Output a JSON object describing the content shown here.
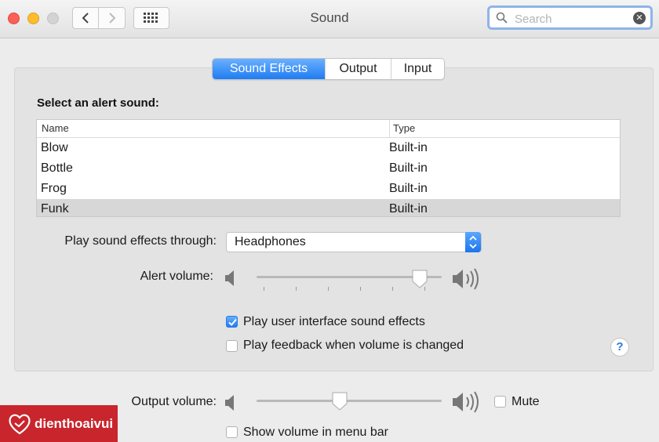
{
  "window": {
    "title": "Sound"
  },
  "search": {
    "placeholder": "Search"
  },
  "tabs": [
    {
      "label": "Sound Effects",
      "active": true
    },
    {
      "label": "Output",
      "active": false
    },
    {
      "label": "Input",
      "active": false
    }
  ],
  "alert_sounds": {
    "heading": "Select an alert sound:",
    "columns": [
      "Name",
      "Type"
    ],
    "rows": [
      {
        "name": "Blow",
        "type": "Built-in"
      },
      {
        "name": "Bottle",
        "type": "Built-in"
      },
      {
        "name": "Frog",
        "type": "Built-in"
      },
      {
        "name": "Funk",
        "type": "Built-in",
        "selected": true
      }
    ]
  },
  "play_through": {
    "label": "Play sound effects through:",
    "value": "Headphones"
  },
  "alert_volume": {
    "label": "Alert volume:",
    "level": 0.88
  },
  "checkboxes": {
    "ui_sounds": {
      "label": "Play user interface sound effects",
      "checked": true
    },
    "feedback": {
      "label": "Play feedback when volume is changed",
      "checked": false
    },
    "show_menu_bar": {
      "label": "Show volume in menu bar",
      "checked": false
    },
    "mute": {
      "label": "Mute",
      "checked": false
    }
  },
  "output_volume": {
    "label": "Output volume:",
    "level": 0.45
  },
  "help": {
    "symbol": "?"
  },
  "brand": {
    "name": "dienthoaivui"
  },
  "colors": {
    "accent": "#1f7cf2",
    "brand_red": "#c9252d"
  }
}
